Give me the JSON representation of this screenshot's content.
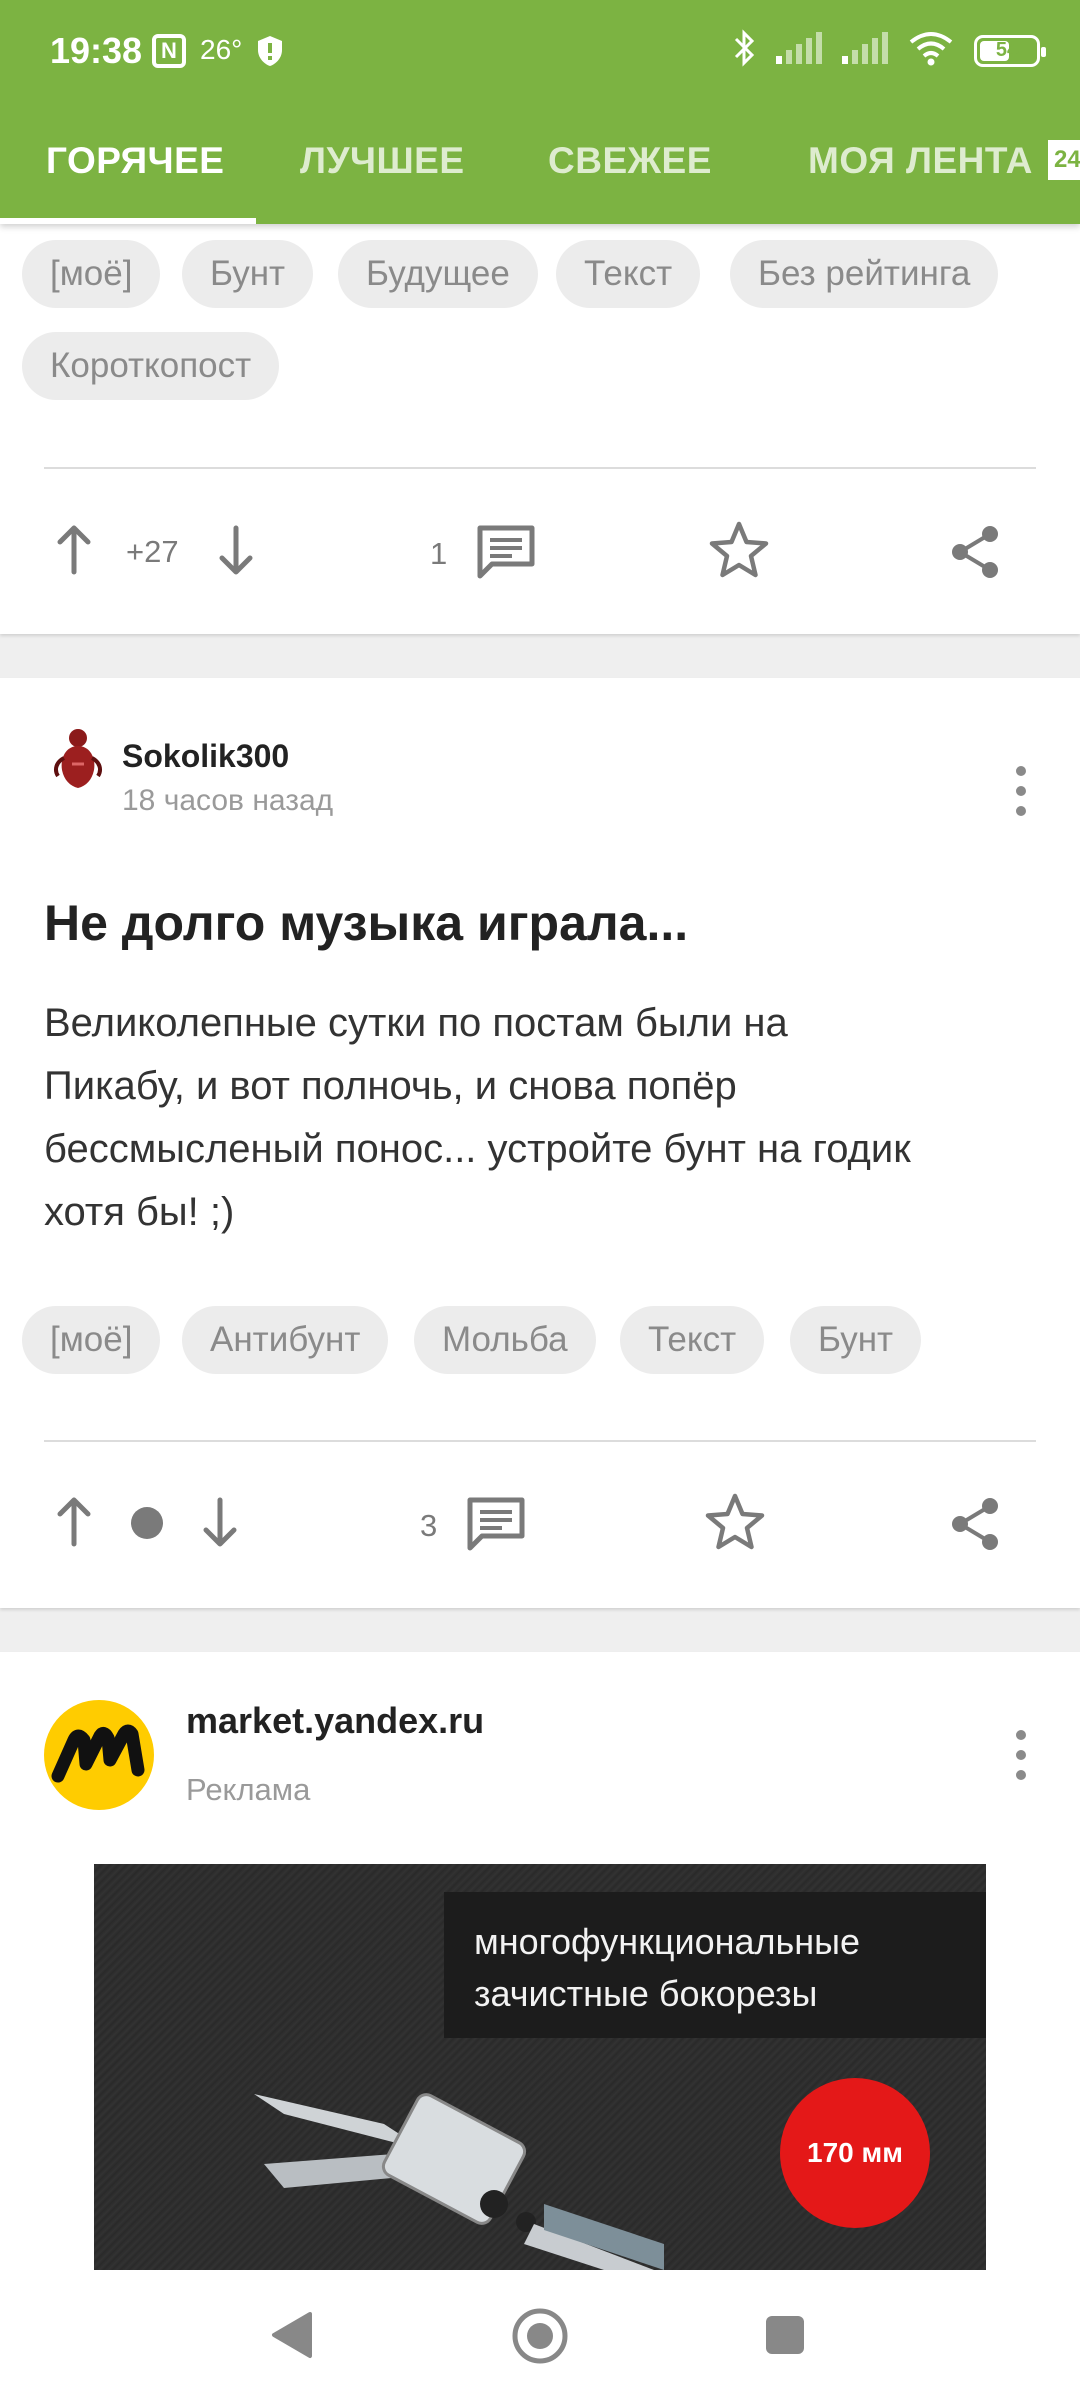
{
  "status_bar": {
    "time": "19:38",
    "nfc": "N",
    "temperature": "26°",
    "battery": "54",
    "battery_level": 0.54
  },
  "tabs": [
    {
      "label": "ГОРЯЧЕЕ",
      "active": true
    },
    {
      "label": "ЛУЧШЕЕ",
      "active": false
    },
    {
      "label": "СВЕЖЕЕ",
      "active": false
    },
    {
      "label": "МОЯ ЛЕНТА",
      "active": false
    }
  ],
  "tab_badge": "24",
  "post1": {
    "tags": [
      "[моё]",
      "Бунт",
      "Будущее",
      "Текст",
      "Без рейтинга",
      "Коротко­пост"
    ],
    "rating": "+27",
    "comments": "1"
  },
  "post2": {
    "author": "Sokolik300",
    "time": "18 часов назад",
    "title": "Не долго музыка играла...",
    "body_lines": [
      "Великолепные сутки по постам были на",
      "Пикабу, и вот полночь, и снова попёр",
      "бессмысленый понос... устройте бунт на годик",
      "хотя бы! ;)"
    ],
    "tags": [
      "[моё]",
      "Антибунт",
      "Мольба",
      "Текст",
      "Бунт"
    ],
    "comments": "3"
  },
  "ad": {
    "source": "market.yandex.ru",
    "label": "Реклама",
    "banner_line1": "многофункциональные",
    "banner_line2": "зачистные бокорезы",
    "banner_badge": "170 мм"
  },
  "colors": {
    "brand_green": "#7cb342",
    "ad_red": "#e41818",
    "ad_yellow": "#ffcc00"
  }
}
